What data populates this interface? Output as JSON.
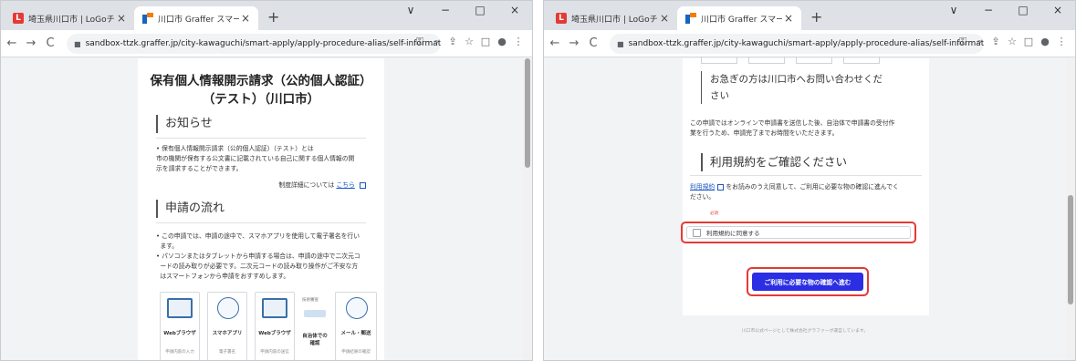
{
  "left": {
    "tabs": [
      {
        "favicon_text": "L",
        "title": "埼玉県川口市 | LoGoチャット",
        "close": "×"
      },
      {
        "title": "川口市 Graffer スマート申請 申請の",
        "close": "×"
      }
    ],
    "new_tab": "+",
    "window_controls": [
      "∨",
      "−",
      "□",
      "×"
    ],
    "nav": {
      "back": "←",
      "forward": "→",
      "reload": "C"
    },
    "url": "sandbox-ttzk.graffer.jp/city-kawaguchi/smart-apply/apply-procedure-alias/self-information-disclosure/...",
    "toolbar_icons": [
      "⚿",
      "⌕",
      "⇪",
      "☆",
      "□",
      "●",
      "⋮"
    ],
    "page": {
      "title_line1": "保有個人情報開示請求（公的個人認証）",
      "title_line2": "（テスト）（川口市）",
      "notice_heading": "お知らせ",
      "notice_lines": [
        "保有個人情報開示請求（公的個人認証）（テスト）とは",
        "市の機関が保有する公文書に記載されている自己に関する個人情報の開",
        "示を請求することができます。"
      ],
      "detail_prefix": "制度詳細については",
      "detail_link": "こちら",
      "flow_heading": "申請の流れ",
      "flow_bullets": [
        "この申請では、申請の途中で、スマホアプリを使用して電子署名を行い",
        "ます。",
        "パソコンまたはタブレットから申請する場合は、申請の途中で二次元コ",
        "ードの読み取りが必要です。二次元コードの読み取り操作がご不安な方",
        "はスマートフォンから申請をおすすめします。"
      ],
      "flow_steps": [
        {
          "label": "Webブラウザ",
          "sub": "申請内容の入力"
        },
        {
          "label": "スマホアプリ",
          "sub": "電子署名"
        },
        {
          "label": "Webブラウザ",
          "sub": "申請内容の送信"
        },
        {
          "label": "自治体での",
          "label2": "確認",
          "top": "技術審査"
        },
        {
          "label": "メール・郵送",
          "sub": "申請結果の確認"
        }
      ]
    }
  },
  "right": {
    "tabs": [
      {
        "favicon_text": "L",
        "title": "埼玉県川口市 | LoGoチャット",
        "close": "×"
      },
      {
        "title": "川口市 Graffer スマート申請 申請の",
        "close": "×"
      }
    ],
    "new_tab": "+",
    "window_controls": [
      "∨",
      "−",
      "□",
      "×"
    ],
    "nav": {
      "back": "←",
      "forward": "→",
      "reload": "C"
    },
    "url": "sandbox-ttzk.graffer.jp/city-kawaguchi/smart-apply/apply-procedure-alias/self-information-disclosure/...",
    "toolbar_icons": [
      "⚿",
      "⌕",
      "⇪",
      "☆",
      "□",
      "●",
      "⋮"
    ],
    "page": {
      "urgent_line1": "お急ぎの方は川口市へお問い合わせくだ",
      "urgent_line2": "さい",
      "online_note_line1": "この申請ではオンラインで申請書を送信した後、自治体で申請書の受付作",
      "online_note_line2": "業を行うため、申請完了までお時間をいただきます。",
      "terms_heading": "利用規約をご確認ください",
      "terms_link": "利用規約",
      "terms_text_line1": "をお読みのうえ同意して、ご利用に必要な物の確認に進んでく",
      "terms_text_line2": "ださい。",
      "required": "必須",
      "agree_label": "利用規約に同意する",
      "proceed_button": "ご利用に必要な物の確認へ進む",
      "footer": "川口市公式ページとして株式会社グラファーが運営しています。"
    }
  }
}
